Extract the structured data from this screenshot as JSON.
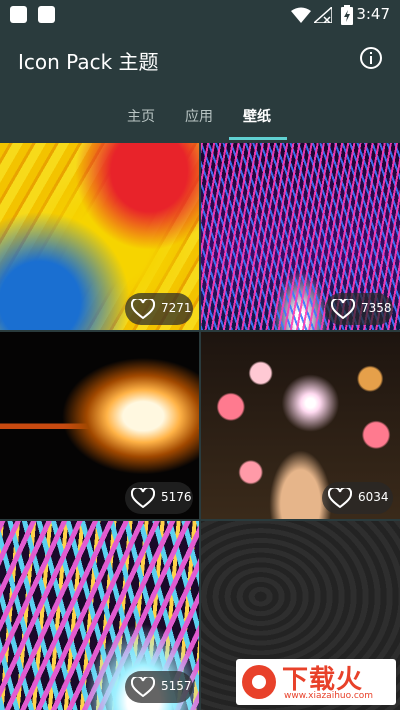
{
  "status_bar": {
    "time": "3:47",
    "icons": [
      "notification-square-icon",
      "notification-square-icon",
      "wifi-icon",
      "no-signal-icon",
      "battery-charging-icon"
    ]
  },
  "app_bar": {
    "title": "Icon Pack 主题",
    "info_icon": "info-icon"
  },
  "tabs": [
    {
      "label": "主页",
      "active": false
    },
    {
      "label": "应用",
      "active": false
    },
    {
      "label": "壁纸",
      "active": true
    }
  ],
  "accent_color": "#60d1d2",
  "background_color": "#2a3b3d",
  "wallpapers": [
    {
      "likes": "7271",
      "subject": "parrot feathers"
    },
    {
      "likes": "7358",
      "subject": "light waves"
    },
    {
      "likes": "5176",
      "subject": "burning match"
    },
    {
      "likes": "6034",
      "subject": "sparkler bokeh"
    },
    {
      "likes": "5157",
      "subject": "colorful light beams"
    },
    {
      "likes": null,
      "subject": "dark texture"
    }
  ],
  "watermark": {
    "brand": "下载火",
    "url": "www.xiazaihuo.com"
  }
}
